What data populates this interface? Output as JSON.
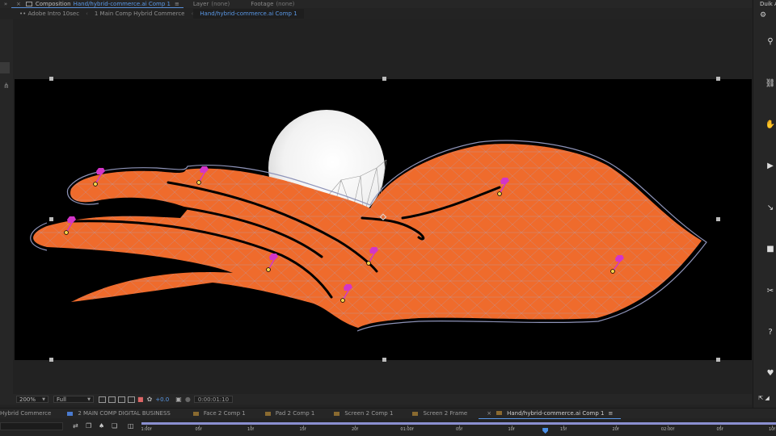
{
  "panel_header": {
    "composition_label": "Composition",
    "composition_name": "Hand/hybrid-commerce.ai Comp 1",
    "layer_label": "Layer",
    "layer_value": "(none)",
    "footage_label": "Footage",
    "footage_value": "(none)"
  },
  "breadcrumbs": [
    "Adobe Intro 10sec",
    "1 Main Comp Hybrid Commerce",
    "Hand/hybrid-commerce.ai Comp 1"
  ],
  "breadcrumb_prefix": "••",
  "right_panel": {
    "title": "Duik Ar",
    "icons": [
      "gear-icon",
      "bone-icon",
      "link-icon",
      "hand-icon",
      "play-icon",
      "ik-icon",
      "camera-icon",
      "tools-icon",
      "help-icon",
      "heart-icon"
    ]
  },
  "viewer_controls": {
    "zoom": "200%",
    "resolution": "Full",
    "exposure": "+0.0",
    "timecode": "0:00:01:10"
  },
  "timeline_tabs": [
    {
      "label": "Hybrid Commerce",
      "color": "#3a8a3a"
    },
    {
      "label": "2 MAIN COMP DIGITAL BUSINESS",
      "color": "#4a7bd0"
    },
    {
      "label": "Face 2 Comp 1",
      "color": "#8a6a30"
    },
    {
      "label": "Pad 2 Comp 1",
      "color": "#8a6a30"
    },
    {
      "label": "Screen 2 Comp 1",
      "color": "#8a6a30"
    },
    {
      "label": "Screen 2 Frame",
      "color": "#8a6a30"
    },
    {
      "label": "Hand/hybrid-commerce.ai Comp 1",
      "color": "#8a6a30"
    }
  ],
  "ruler": {
    "ticks": [
      "1:00f",
      "05f",
      "10f",
      "15f",
      "20f",
      "01:00f",
      "05f",
      "10f",
      "15f",
      "20f",
      "02:00f",
      "05f",
      "10f"
    ],
    "playhead_fraction": 0.64
  },
  "colors": {
    "accent": "#5a98e6",
    "hand": "#ef6b2c",
    "mesh": "#8e93b8",
    "pin": "#d335c8",
    "pin_base": "#f6d24a"
  }
}
